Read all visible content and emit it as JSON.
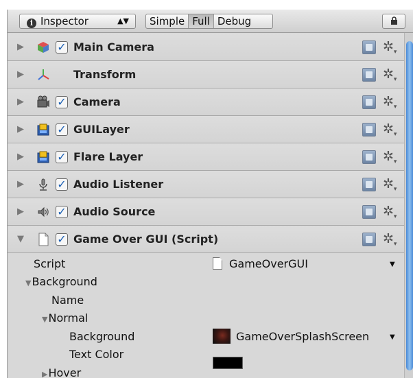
{
  "toolbar": {
    "inspector_label": "Inspector",
    "modes": [
      "Simple",
      "Full",
      "Debug"
    ],
    "active_mode": "Full",
    "lock_icon": "lock-icon"
  },
  "components": [
    {
      "label": "Main Camera",
      "icon": "cube-icon",
      "checked": true,
      "expanded": false
    },
    {
      "label": "Transform",
      "icon": "transform-axes-icon",
      "checked": null,
      "expanded": false
    },
    {
      "label": "Camera",
      "icon": "camera-icon",
      "checked": true,
      "expanded": false
    },
    {
      "label": "GUILayer",
      "icon": "guilayer-icon",
      "checked": true,
      "expanded": false
    },
    {
      "label": "Flare Layer",
      "icon": "flarelayer-icon",
      "checked": true,
      "expanded": false
    },
    {
      "label": "Audio Listener",
      "icon": "audio-listener-icon",
      "checked": true,
      "expanded": false
    },
    {
      "label": "Audio Source",
      "icon": "speaker-icon",
      "checked": true,
      "expanded": false
    },
    {
      "label": "Game Over GUI (Script)",
      "icon": "script-file-icon",
      "checked": true,
      "expanded": true
    }
  ],
  "properties": {
    "script_label": "Script",
    "script_value": "GameOverGUI",
    "background_label": "Background",
    "name_label": "Name",
    "normal_label": "Normal",
    "normal_background_label": "Background",
    "normal_background_value": "GameOverSplashScreen",
    "text_color_label": "Text Color",
    "text_color_value": "#000000",
    "hover_label": "Hover"
  },
  "colors": {
    "panel_bg": "#d8d8d8",
    "checkmark": "#1a5fb4",
    "scrollbar": "#4a8ad6"
  }
}
